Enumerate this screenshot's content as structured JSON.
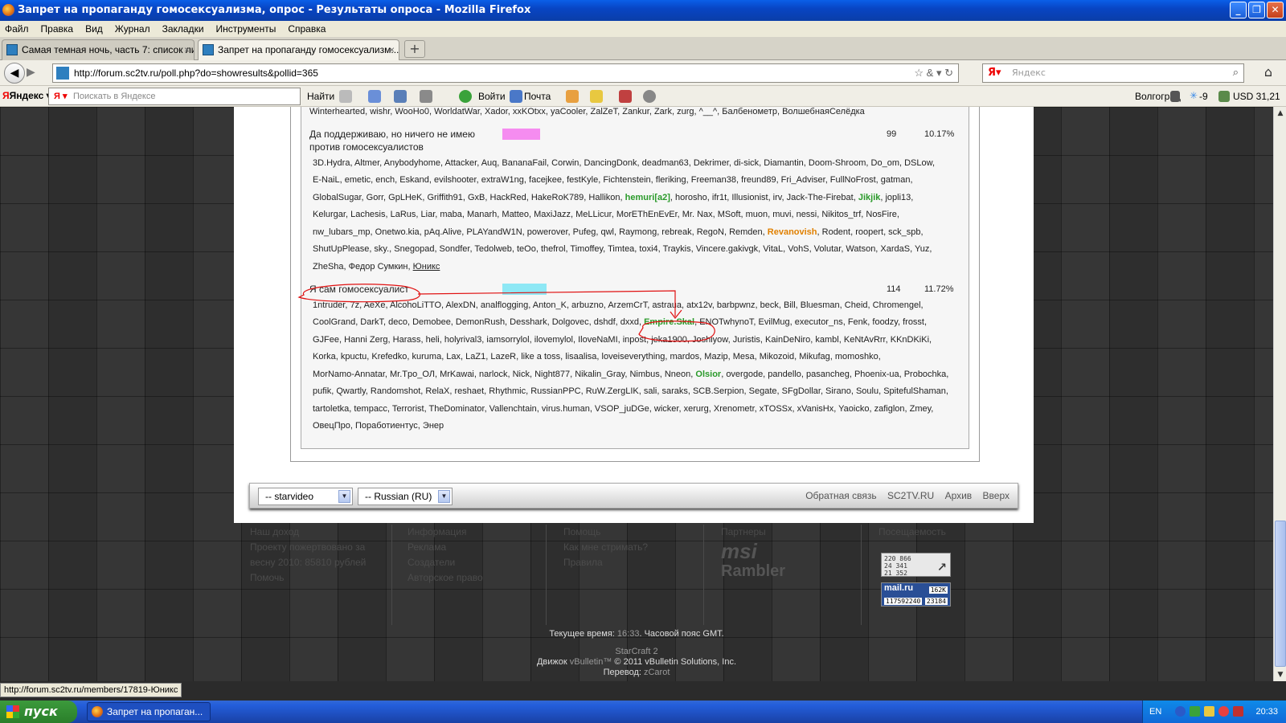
{
  "window": {
    "title": "Запрет на пропаганду гомосексуализма, опрос - Результаты опроса - Mozilla Firefox"
  },
  "menu": [
    "Файл",
    "Правка",
    "Вид",
    "Журнал",
    "Закладки",
    "Инструменты",
    "Справка"
  ],
  "tabs": [
    {
      "label": "Самая темная ночь, часть 7: список ли...",
      "close": "×"
    },
    {
      "label": "Запрет на пропаганду гомосексуализм...",
      "close": "×"
    }
  ],
  "new_tab": "+",
  "nav": {
    "url": "http://forum.sc2tv.ru/poll.php?do=showresults&pollid=365",
    "search_placeholder": "Яндекс"
  },
  "yandex_bar": {
    "brand": "Яндекс",
    "search_placeholder": "Поискать в Яндексе",
    "find": "Найти",
    "login": "Войти",
    "mail": "Почта",
    "city": "Волгоград",
    "temp": "-9",
    "usd": "USD 31,21"
  },
  "poll": {
    "prev_tail": "Winterhearted, wishr, WooHo0, WorldatWar, Xador, xxKOtxx, yaCooler, ZalZeT, Zankur, Zark, zurg, ^__^, Балбенометр, ВолшебнаяСелёдка",
    "options": [
      {
        "text_line1": "Да поддерживаю, но ничего не имею",
        "text_line2": "против гомосексуалистов",
        "votes": "99",
        "percent": "10.17%",
        "color": "#f58cf0",
        "lines": [
          "3D.Hydra, Altmer, Anybodyhome, Attacker, Auq, BananaFail, Corwin, DancingDonk, deadman63, Dekrimer, di-sick, Diamantin, Doom-Shroom, Do_om, DSLow,",
          "E-NaiL, emetic, ench, Eskand, evilshooter, extraW1ng, facejkee, festKyle, Fichtenstein, fleriking, Freeman38, freund89, Fri_Adviser, FullNoFrost, gatman,",
          {
            "a": "GlobalSugar, Gorr, GpLHeK, Griffith91, GxB, HackRed, HakeRoK789, Hallikon, ",
            "b": "hemuri[a2]",
            "c": ", horosho, ifr1t, Illusionist, irv, Jack-The-Firebat, ",
            "d": "Jikjik",
            "e": ", jopli13,"
          },
          "Kelurgar, Lachesis, LaRus, Liar, maba, Manarh, Matteo, MaxiJazz, MeLLicur, MorEThEnEvEr, Mr. Nax, MSoft, muon, muvi, nessi, Nikitos_trf, NosFire,",
          {
            "a": "nw_lubars_mp, Onetwo.kia, pAq.Alive, PLAYandW1N, powerover, Pufeg, qwl, Raymong, rebreak, RegoN, Remden, ",
            "b": "Revanovish",
            "c": ", Rodent, roopert, sck_spb,"
          },
          "ShutUpPlease, sky., Snegopad, Sondfer, Tedolweb, teOo, thefrol, Timoffey, Timtea, toxi4, Traykis, Vincere.gakivgk, VitaL, VohS, Volutar, Watson, XardaS, Yuz,",
          {
            "a": "ZheSha, Федор Сумкин, ",
            "b": "Юникс"
          }
        ]
      },
      {
        "text_line1": "Я сам гомосексуалист",
        "votes": "114",
        "percent": "11.72%",
        "color": "#8ee8f5",
        "lines": [
          "1ntruder, 7z, AeXe, AlcohoLiTTO, AlexDN, analflogging, Anton_K, arbuzno, ArzemCrT, astraua, atx12v, barbpwnz, beck, Bill, Bluesman, Cheid, Chromengel,",
          {
            "a": "CoolGrand, DarkT, deco, Demobee, DemonRush, Desshark, Dolgovec, dshdf, dxxd, ",
            "b": "Empire.Skal",
            "c": ", ENOTwhynoT, EvilMug, executor_ns, Fenk, foodzy, frosst,"
          },
          "GJFee, Hanni Zerg, Harass, heli, holyrival3, iamsorrylol, ilovemylol, IloveNaMI, inpost, jeka1900, Joshiyow, Juristis, KainDeNiro, kambl, KeNtAvRrr, KKnDKiKi,",
          "Korka, kpuctu, Krefedko, kuruma, Lax, LaZ1, LazeR, like a toss, lisaalisa, loveiseverything, mardos, Mazip, Mesa, Mikozoid, Mikufag, momoshko,",
          {
            "a": "MorNamo-Annatar, Mr.Tpo_ОЛ, MrKawai, narlock, Nick, Night877, Nikalin_Gray, Nimbus, Nneon, ",
            "b": "Olsior",
            "c": ", overgode, pandello, pasancheg, Phoenix-ua, Probochka,"
          },
          "pufik, Qwartly, Randomshot, RelaX, reshaet, Rhythmic, RussianPPC, RuW.ZergLIK, sali, saraks, SCB.Serpion, Segate, SFgDollar, Sirano, Soulu, SpitefulShaman,",
          "tartoletka, tempacc, Terrorist, TheDominator, Vallenchtain, virus.human, VSOP_juDGe, wicker, xerurg, Xrenometr, xTOSSx, xVanisHx, Yaoicko, zafiglon, Zmey,",
          "ОвецПро, Поработиентус, Энер"
        ]
      }
    ]
  },
  "footer": {
    "style_select": "-- starvideo",
    "lang_select": "-- Russian (RU)",
    "links": [
      "Обратная связь",
      "SC2TV.RU",
      "Архив",
      "Вверх"
    ],
    "cols": [
      {
        "head": "Наш доход",
        "lines": [
          "Проекту пожертвовано за",
          "весну 2010: 85810 рублей",
          "Помочь"
        ]
      },
      {
        "head": "Информация",
        "lines": [
          "Реклама",
          "Создатели",
          "Авторское право"
        ]
      },
      {
        "head": "Помощь",
        "lines": [
          "Как мне стримать?",
          "Правила"
        ]
      },
      {
        "head": "Партнеры",
        "lines": [
          "msi",
          "Rambler"
        ]
      },
      {
        "head": "Посещаемость",
        "lines": []
      }
    ],
    "counter1": [
      "220 866",
      "24 341",
      "21 352"
    ],
    "counter2": {
      "brand": "mail.ru",
      "a": "162K",
      "b": "117592240",
      "c": "23184"
    },
    "time_label": "Текущее время: ",
    "time": "16:33",
    "tz": ". Часовой пояс GMT.",
    "game": "StarCraft 2",
    "engine_label": "Движок ",
    "engine": "vBulletin™",
    "copyright": " © 2011 vBulletin Solutions, Inc.",
    "translation_label": "Перевод: ",
    "translation": "zCarot"
  },
  "status_url": "http://forum.sc2tv.ru/members/17819-Юникс",
  "taskbar": {
    "start": "пуск",
    "task": "Запрет на пропаган...",
    "lang": "EN",
    "clock": "20:33"
  }
}
